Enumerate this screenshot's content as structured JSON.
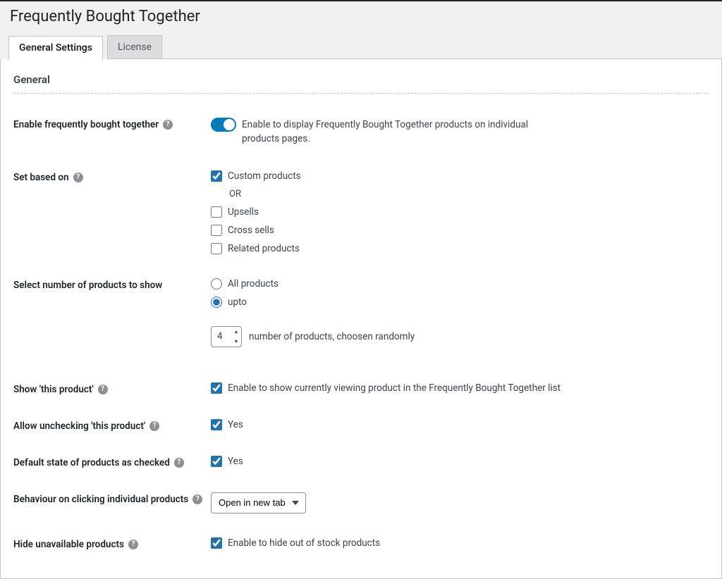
{
  "page": {
    "title": "Frequently Bought Together"
  },
  "tabs": {
    "general": "General Settings",
    "license": "License"
  },
  "section": {
    "heading": "General"
  },
  "rows": {
    "enable": {
      "label": "Enable frequently bought together",
      "desc": "Enable to display Frequently Bought Together products on individual products pages."
    },
    "set_based": {
      "label": "Set based on",
      "opt_custom": "Custom products",
      "or": "OR",
      "opt_upsells": "Upsells",
      "opt_cross": "Cross sells",
      "opt_related": "Related products"
    },
    "num_products": {
      "label": "Select number of products to show",
      "opt_all": "All products",
      "opt_upto": "upto",
      "value": "4",
      "suffix": "number of products, choosen randomly"
    },
    "show_this": {
      "label": "Show 'this product'",
      "desc": "Enable to show currently viewing product in the Frequently Bought Together list"
    },
    "allow_uncheck": {
      "label": "Allow unchecking 'this product'",
      "yes": "Yes"
    },
    "default_checked": {
      "label": "Default state of products as checked",
      "yes": "Yes"
    },
    "behaviour": {
      "label": "Behaviour on clicking individual products",
      "selected": "Open in new tab"
    },
    "hide_unavailable": {
      "label": "Hide unavailable products",
      "desc": "Enable to hide out of stock products"
    }
  }
}
